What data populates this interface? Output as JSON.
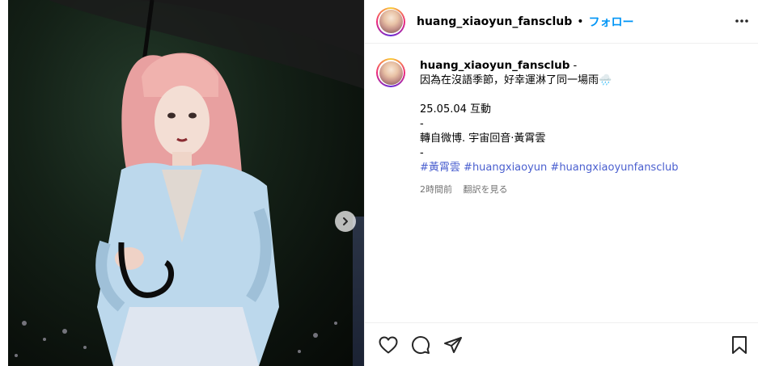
{
  "post": {
    "username": "huang_xiaoyun_fansclub",
    "dot": "•",
    "follow_label": "フォロー",
    "more_icon": "more-horizontal-icon"
  },
  "caption": {
    "username": "huang_xiaoyun_fansclub",
    "lines": [
      "-",
      "因為在沒語季節，好幸運淋了同一場雨🌧️",
      "25.05.04 互動",
      "-",
      "轉自微博. 宇宙回音·黃霄雲",
      "-"
    ],
    "hashtags": [
      "#黃霄雲",
      "#huangxiaoyun",
      "#huangxiaoyunfansclub"
    ]
  },
  "meta": {
    "time": "2時間前",
    "translate": "翻訳を見る"
  },
  "actions": {
    "like_icon": "heart-icon",
    "comment_icon": "comment-icon",
    "share_icon": "send-icon",
    "save_icon": "bookmark-icon"
  },
  "media": {
    "next_icon": "chevron-right-icon"
  },
  "colors": {
    "accent": "#0095f6",
    "hashtag": "#4a5fcf",
    "meta": "#737373"
  }
}
